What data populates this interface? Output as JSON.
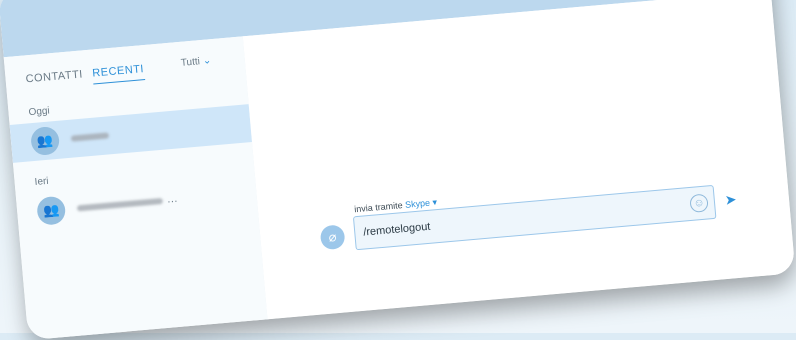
{
  "tabs": {
    "contacts_label": "CONTATTI",
    "recents_label": "RECENTI"
  },
  "filter": {
    "label": "Tutti"
  },
  "groups": [
    {
      "label": "Oggi"
    },
    {
      "label": "Ieri"
    }
  ],
  "compose": {
    "send_via_prefix": "invia tramite",
    "send_via_service": "Skype",
    "message_value": "/remotelogout"
  },
  "icons": {
    "filter": "chevron-down-icon",
    "group_avatar": "group-icon",
    "emoji": "emoji-icon",
    "send": "send-icon",
    "attach": "paperclip-icon"
  },
  "colors": {
    "accent": "#2d90d8",
    "selected_row": "#cfe6f9",
    "sidebar_bg": "#f7fbfd",
    "avatar_bg": "#95bfe0"
  }
}
